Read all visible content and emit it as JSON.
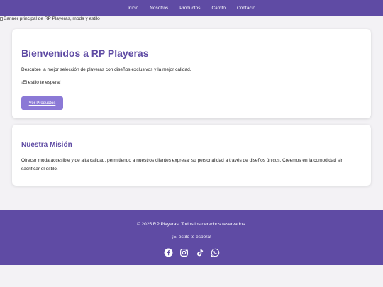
{
  "nav": {
    "items": [
      {
        "label": "Inicio"
      },
      {
        "label": "Nosotros"
      },
      {
        "label": "Productos"
      },
      {
        "label": "Carrito"
      },
      {
        "label": "Contacto"
      }
    ]
  },
  "banner": {
    "alt": "Banner principal de RP Playeras, moda y estilo"
  },
  "welcome": {
    "title": "Bienvenidos a RP Playeras",
    "description": "Descubre la mejor selección de playeras con diseños exclusivos y la mejor calidad.",
    "tagline": "¡El estilo te espera!",
    "button_label": "Ver Productos"
  },
  "mission": {
    "title": "Nuestra Misión",
    "text": "Ofrecer moda accesible y de alta calidad, permitiendo a nuestros clientes expresar su personalidad a través de diseños únicos. Creemos en la comodidad sin sacrificar el estilo."
  },
  "footer": {
    "copyright": "© 2025 RP Playeras. Todos los derechos reservados.",
    "tagline": "¡El estilo te espera!",
    "socials": [
      "facebook-icon",
      "instagram-icon",
      "tiktok-icon",
      "whatsapp-icon"
    ]
  },
  "colors": {
    "brand": "#5f4ba4",
    "button": "#8b79d6",
    "background": "#f3f2f5"
  }
}
